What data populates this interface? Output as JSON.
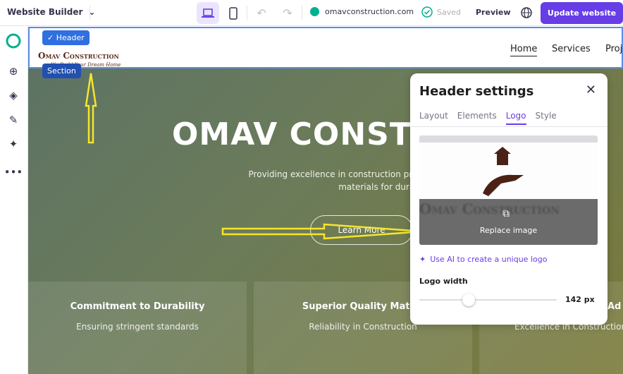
{
  "topbar": {
    "app_title": "Website Builder",
    "domain": "omavconstruction.com",
    "saved": "Saved",
    "preview": "Preview",
    "update": "Update website"
  },
  "colors": {
    "accent": "#673de6",
    "status": "#00b090",
    "selection": "#2f6fe0"
  },
  "sidebar": {
    "icons": [
      "progress-icon",
      "add-icon",
      "layers-icon",
      "design-icon",
      "ai-sparkle-icon",
      "more-icon"
    ]
  },
  "site": {
    "logo": "Omav Construction",
    "logo_tagline": "We Build Your Dream Home",
    "nav": [
      "Home",
      "Services",
      "Proj"
    ],
    "hero_title": "OMAV CONSTR",
    "hero_subtitle": "Providing excellence in construction practices",
    "hero_subtitle2": "materials for durability.",
    "cta": "Learn More",
    "cards": [
      {
        "title": "Commitment to Durability",
        "desc": "Ensuring stringent standards"
      },
      {
        "title": "Superior Quality Materi",
        "desc": "Reliability in Construction"
      },
      {
        "title": "Ad",
        "desc": "Excellence in Construction"
      }
    ],
    "tags": {
      "header": "Header",
      "section": "Section"
    }
  },
  "panel": {
    "title": "Header settings",
    "tabs": [
      "Layout",
      "Elements",
      "Logo",
      "Style"
    ],
    "active_tab": "Logo",
    "replace": "Replace image",
    "ai_link": "Use AI to create a unique logo",
    "width_label": "Logo width",
    "width_value": "142 px",
    "slider_percent": 36
  }
}
